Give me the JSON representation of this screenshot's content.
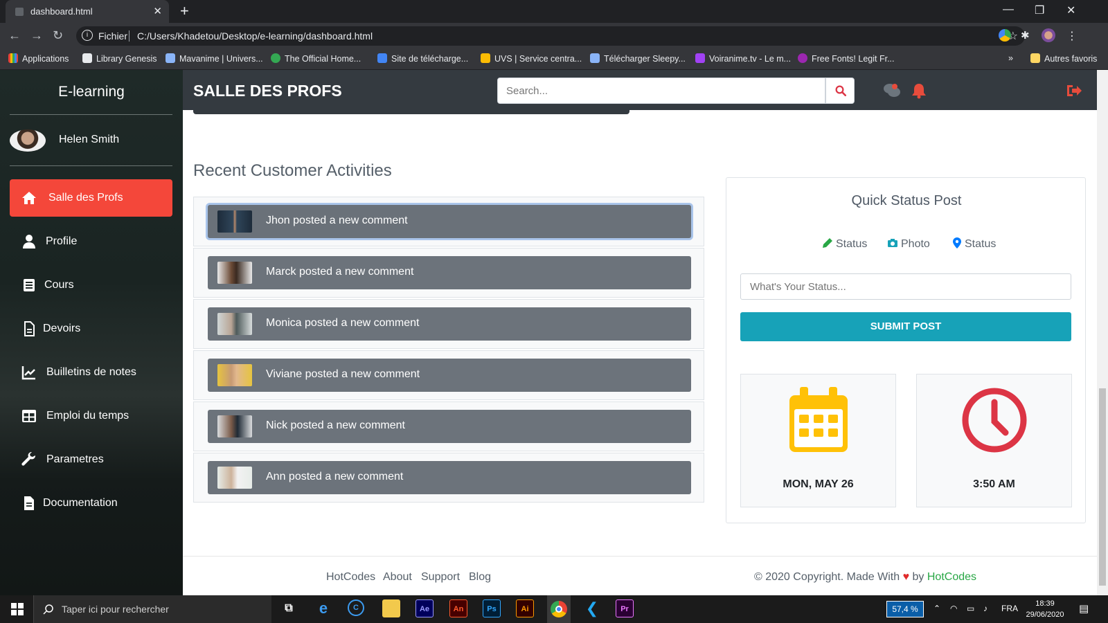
{
  "browser": {
    "tab_title": "dashboard.html",
    "protocol_label": "Fichier",
    "url": "C:/Users/Khadetou/Desktop/e-learning/dashboard.html",
    "bookmarks": [
      {
        "label": "Applications",
        "color": "#ea4335"
      },
      {
        "label": "Library Genesis",
        "color": "#e8eaed"
      },
      {
        "label": "Mavanime | Univers...",
        "color": "#8ab4f8"
      },
      {
        "label": "The Official Home...",
        "color": "#34a853"
      },
      {
        "label": "Site de télécharge...",
        "color": "#4285f4"
      },
      {
        "label": "UVS | Service centra...",
        "color": "#fbbc04"
      },
      {
        "label": "Télécharger Sleepy...",
        "color": "#8ab4f8"
      },
      {
        "label": "Voiranime.tv - Le m...",
        "color": "#a142f4"
      },
      {
        "label": "Free Fonts! Legit Fr...",
        "color": "#9c27b0"
      }
    ],
    "bookmarks_more": "»",
    "other_bookmarks": "Autres favoris"
  },
  "sidebar": {
    "brand": "E-learning",
    "user_name": "Helen Smith",
    "items": [
      {
        "label": "Salle des Profs",
        "icon": "home-icon",
        "active": true
      },
      {
        "label": "Profile",
        "icon": "user-icon"
      },
      {
        "label": "Cours",
        "icon": "book-icon"
      },
      {
        "label": "Devoirs",
        "icon": "file-icon"
      },
      {
        "label": "Builletins de notes",
        "icon": "chart-line-icon"
      },
      {
        "label": "Emploi du temps",
        "icon": "table-icon"
      },
      {
        "label": "Parametres",
        "icon": "wrench-icon"
      },
      {
        "label": "Documentation",
        "icon": "document-icon"
      }
    ]
  },
  "header": {
    "title": "SALLE DES PROFS",
    "search_placeholder": "Search..."
  },
  "activities": {
    "title": "Recent Customer Activities",
    "items": [
      {
        "text": "Jhon posted a new comment"
      },
      {
        "text": "Marck posted a new comment"
      },
      {
        "text": "Monica posted a new comment"
      },
      {
        "text": "Viviane posted a new comment"
      },
      {
        "text": "Nick posted a new comment"
      },
      {
        "text": "Ann posted a new comment"
      }
    ]
  },
  "status": {
    "title": "Quick Status Post",
    "options": [
      {
        "label": "Status",
        "icon": "pencil-icon",
        "color": "#28a745"
      },
      {
        "label": "Photo",
        "icon": "camera-icon",
        "color": "#17a2b8"
      },
      {
        "label": "Status",
        "icon": "map-marker-icon",
        "color": "#007bff"
      }
    ],
    "input_placeholder": "What's Your Status...",
    "submit_label": "SUBMIT POST",
    "date": "MON, MAY 26",
    "time": "3:50 AM"
  },
  "footer": {
    "links": [
      "HotCodes",
      "About",
      "Support",
      "Blog"
    ],
    "copyright_prefix": "© 2020 Copyright. Made With",
    "copyright_by": "by",
    "copyright_brand": "HotCodes"
  },
  "taskbar": {
    "search_placeholder": "Taper ici pour rechercher",
    "zoom": "57,4 %",
    "language": "FRA",
    "time": "18:39",
    "date": "29/06/2020",
    "apps": [
      {
        "label": "Ae",
        "color": "#00005b",
        "fg": "#9999ff"
      },
      {
        "label": "An",
        "color": "#470000",
        "fg": "#ff5a2c"
      },
      {
        "label": "Ps",
        "color": "#001e36",
        "fg": "#31a8ff"
      },
      {
        "label": "Ai",
        "color": "#330000",
        "fg": "#ff9a00"
      },
      {
        "label": "Pr",
        "color": "#2a0033",
        "fg": "#ea77ff"
      }
    ]
  }
}
